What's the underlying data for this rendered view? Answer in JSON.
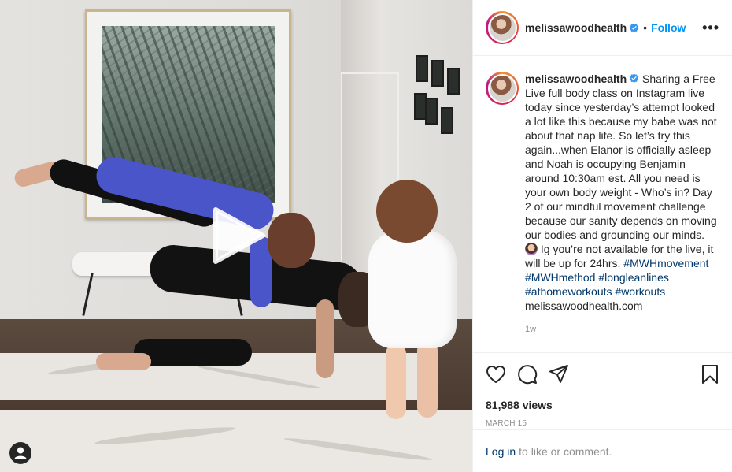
{
  "post": {
    "username": "melissawoodhealth",
    "follow_label": "Follow",
    "dot": "•",
    "more_label": "•••",
    "caption_text": "Sharing a Free Live full body class on Instagram live today since yesterday’s attempt looked a lot like this because my babe was not about that nap life. So let’s try this again...when Elanor is officially asleep and Noah is occupying Benjamin around 10:30am est. All you need is your own body weight - Who’s in? Day 2 of our mindful movement challenge because our sanity depends on moving our bodies and grounding our minds.",
    "caption_text2": "Ig you’re not available for the live, it will be up for 24hrs.",
    "hashtags": [
      "#MWHmovement",
      "#MWHmethod",
      "#longleanlines",
      "#athomeworkouts",
      "#workouts"
    ],
    "link": "melissawoodhealth.com",
    "time_ago": "1w",
    "views": "81,988 views",
    "date": "MARCH 15"
  },
  "icons": {
    "like": "heart-icon",
    "comment": "comment-icon",
    "share": "share-icon",
    "save": "bookmark-icon",
    "verified": "verified-badge-icon",
    "play": "play-icon",
    "user": "user-icon"
  },
  "login": {
    "link_label": "Log in",
    "suffix": "to like or comment."
  },
  "colors": {
    "accent": "#0095f6",
    "link": "#00376b",
    "muted": "#8e8e8e"
  }
}
